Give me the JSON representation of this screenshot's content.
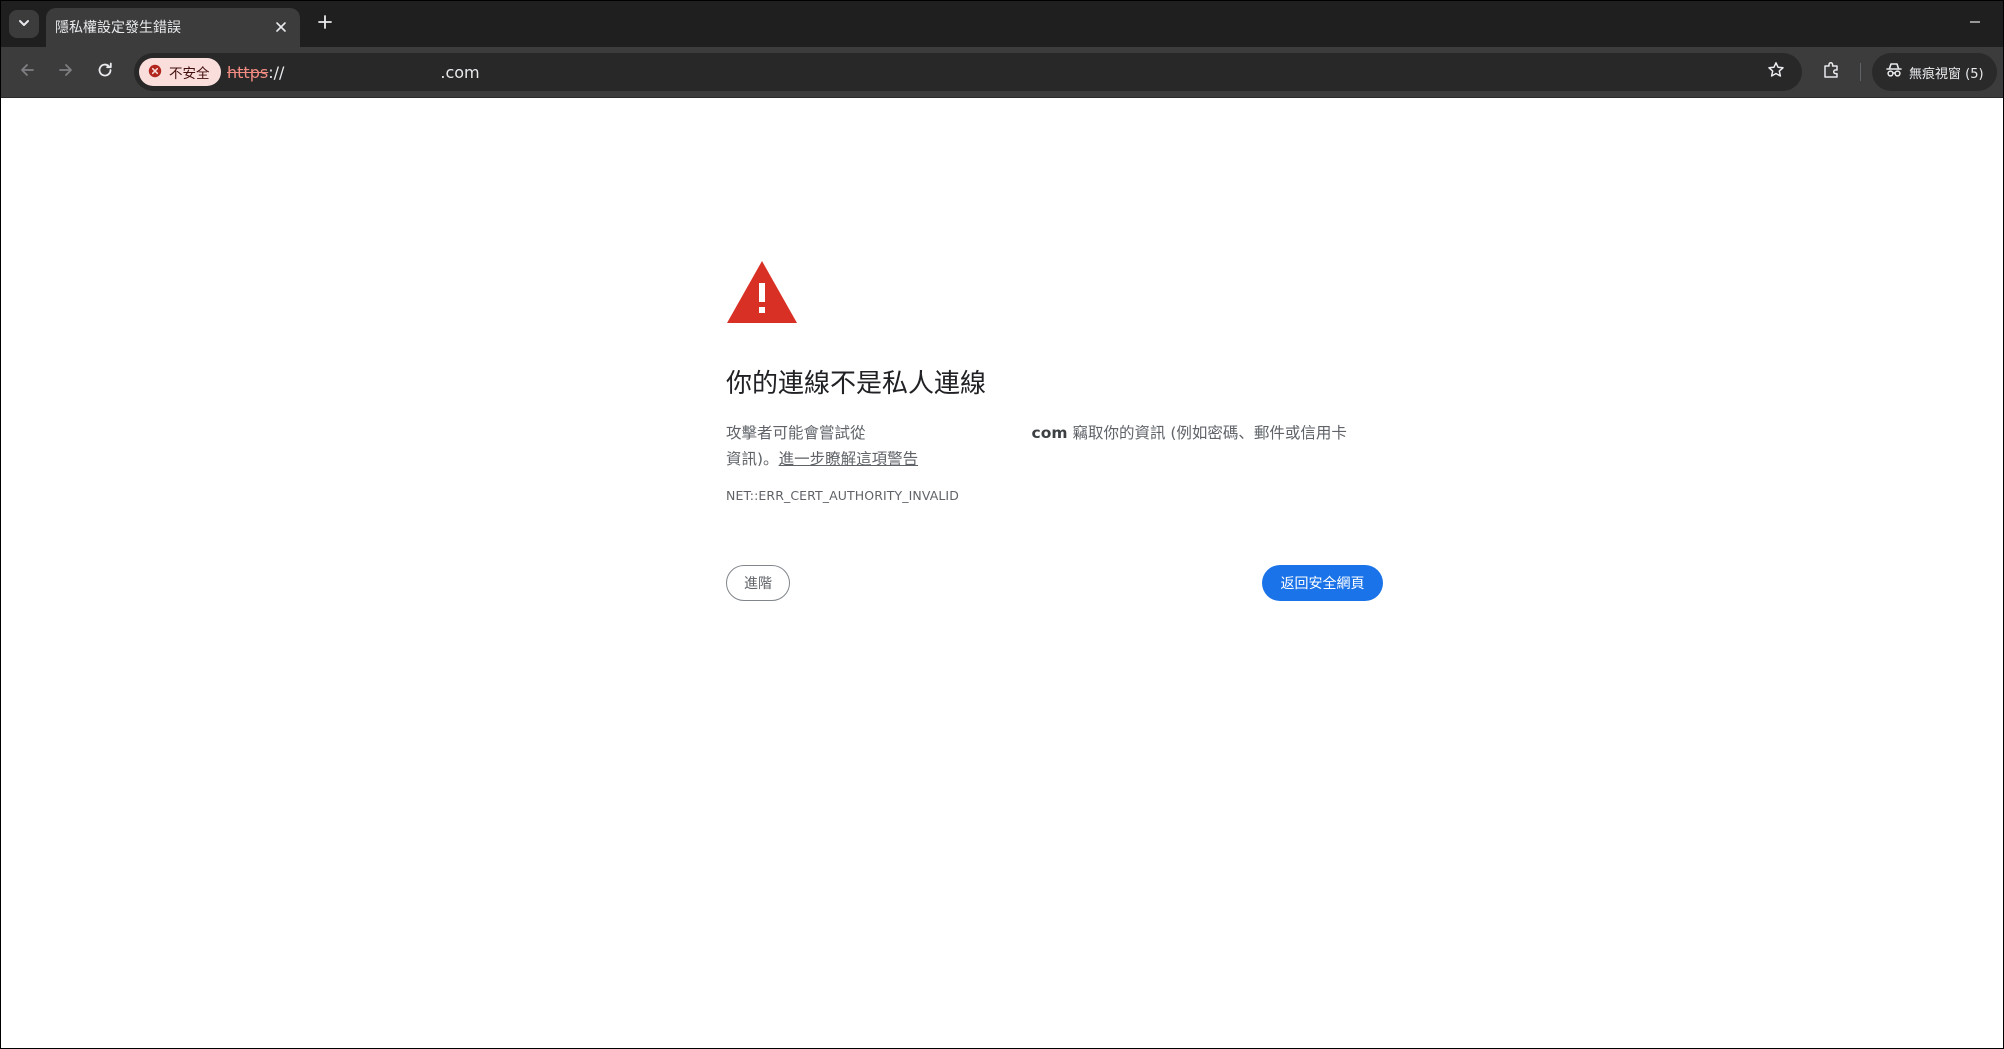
{
  "tab": {
    "title": "隱私權設定發生錯誤"
  },
  "toolbar": {
    "security_label": "不安全",
    "url_scheme": "https",
    "url_separator": "://",
    "url_suffix": ".com"
  },
  "incognito": {
    "label": "無痕視窗 (5)"
  },
  "page": {
    "heading": "你的連線不是私人連線",
    "desc_prefix": "攻擊者可能會嘗試從",
    "desc_host": "com",
    "desc_suffix": " 竊取你的資訊 (例如密碼、郵件或信用卡",
    "desc_line2_prefix": "資訊)。",
    "learn_more": "進一步瞭解這項警告",
    "error_code": "NET::ERR_CERT_AUTHORITY_INVALID",
    "advanced_label": "進階",
    "back_label": "返回安全網頁"
  },
  "colors": {
    "danger": "#d93025",
    "primary": "#1a73e8",
    "chrome_dark": "#1f1f1f",
    "toolbar": "#3c3c3c"
  },
  "icons": {
    "tab_search": "chevron-down-icon",
    "tab_close": "close-icon",
    "new_tab": "plus-icon",
    "back": "arrow-left-icon",
    "forward": "arrow-right-icon",
    "reload": "reload-icon",
    "security": "error-circle-icon",
    "bookmark": "star-icon",
    "extensions": "puzzle-icon",
    "incognito": "incognito-icon",
    "warning": "warning-triangle-icon"
  }
}
